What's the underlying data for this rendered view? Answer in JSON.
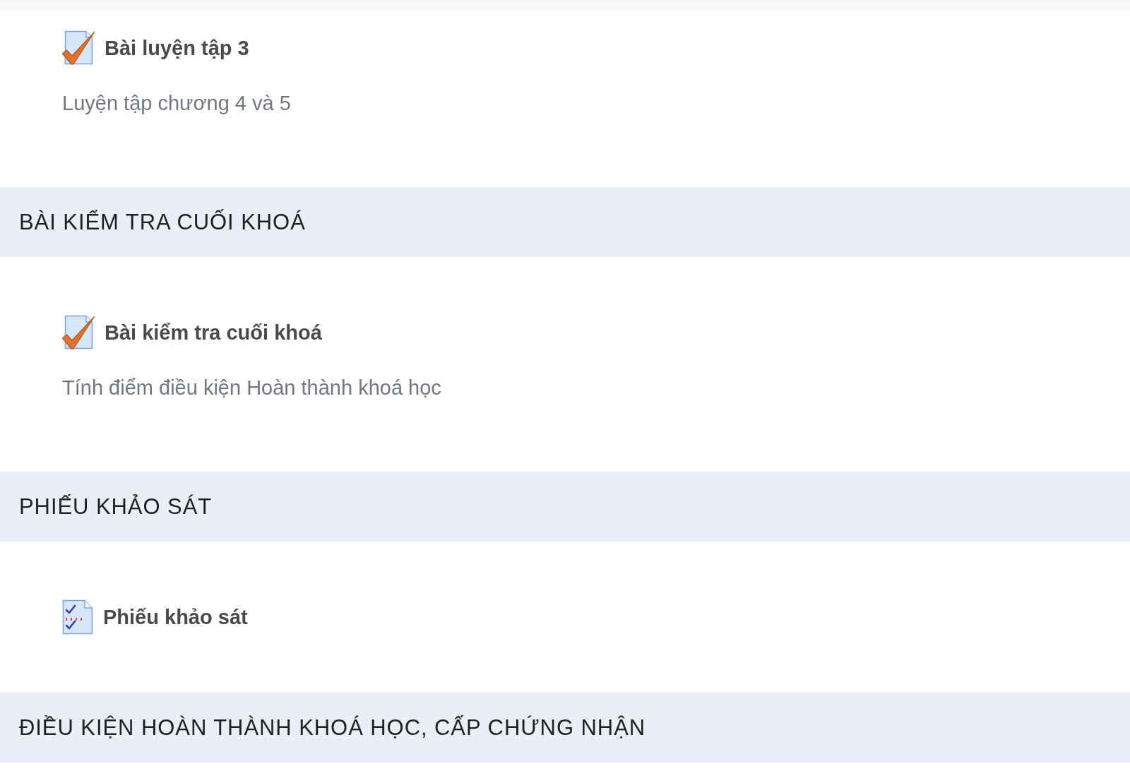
{
  "sections": [
    {
      "items": [
        {
          "kind": "quiz",
          "title": "Bài luyện tập 3",
          "description": "Luyện tập chương 4 và 5"
        }
      ]
    },
    {
      "heading": "BÀI KIỂM TRA CUỐI KHOÁ",
      "items": [
        {
          "kind": "quiz",
          "title": "Bài kiểm tra cuối khoá",
          "description": "Tính điểm điều kiện Hoàn thành khoá học"
        }
      ]
    },
    {
      "heading": "PHIẾU KHẢO SÁT",
      "items": [
        {
          "kind": "survey",
          "title": "Phiếu khảo sát"
        }
      ]
    },
    {
      "heading": "ĐIỀU KIỆN HOÀN THÀNH KHOÁ HỌC, CẤP CHỨNG NHẬN"
    }
  ]
}
